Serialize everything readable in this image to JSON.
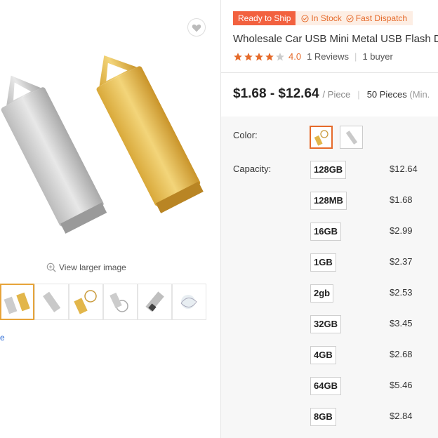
{
  "gallery": {
    "view_larger": "View larger image",
    "left_link": "e"
  },
  "badges": {
    "ready": "Ready to Ship",
    "in_stock": "In Stock",
    "fast_dispatch": "Fast Dispatch"
  },
  "product": {
    "title": "Wholesale Car USB Mini Metal USB Flash D",
    "rating": {
      "stars": 4,
      "score": "4.0",
      "reviews": "1 Reviews",
      "buyers": "1 buyer"
    },
    "price_range": "$1.68 - $12.64",
    "unit": "/ Piece",
    "moq": "50 Pieces",
    "moq_note": "(Min."
  },
  "options": {
    "color_label": "Color:",
    "capacity_label": "Capacity:",
    "capacities": [
      {
        "label": "128GB",
        "price": "$12.64"
      },
      {
        "label": "128MB",
        "price": "$1.68"
      },
      {
        "label": "16GB",
        "price": "$2.99"
      },
      {
        "label": "1GB",
        "price": "$2.37"
      },
      {
        "label": "2gb",
        "price": "$2.53"
      },
      {
        "label": "32GB",
        "price": "$3.45"
      },
      {
        "label": "4GB",
        "price": "$2.68"
      },
      {
        "label": "64GB",
        "price": "$5.46"
      },
      {
        "label": "8GB",
        "price": "$2.84"
      }
    ]
  },
  "colors": {
    "accent": "#e56a2a",
    "ready_bg": "#f2613f",
    "gold": "#e2b64a",
    "silver": "#c9c9c9"
  }
}
